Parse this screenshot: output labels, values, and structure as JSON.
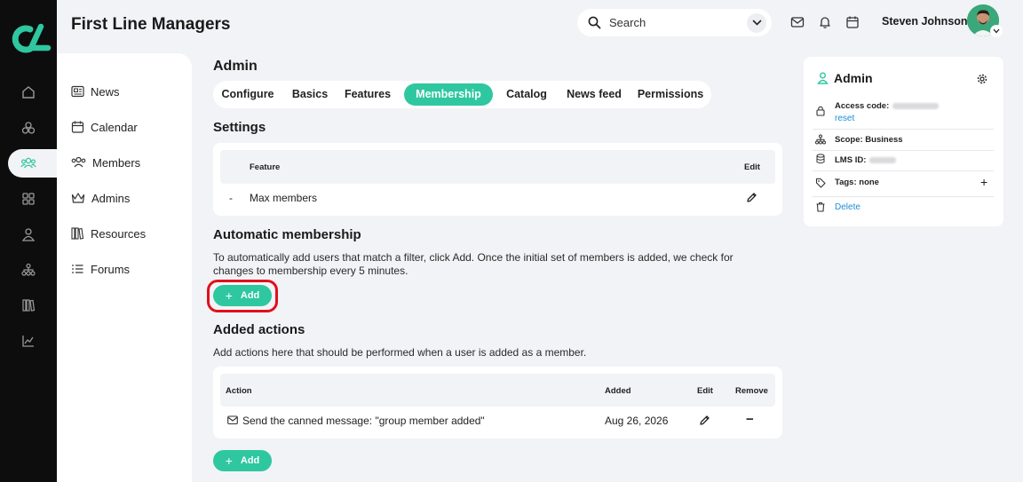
{
  "header": {
    "app_title": "First Line Managers",
    "search_placeholder": "Search",
    "user_name": "Steven Johnson"
  },
  "sidebar": {
    "items": [
      {
        "label": "News",
        "icon": "news-icon"
      },
      {
        "label": "Calendar",
        "icon": "calendar-icon"
      },
      {
        "label": "Members",
        "icon": "members-icon"
      },
      {
        "label": "Admins",
        "icon": "crown-icon"
      },
      {
        "label": "Resources",
        "icon": "books-icon"
      },
      {
        "label": "Forums",
        "icon": "list-icon"
      }
    ]
  },
  "rail": {
    "icons": [
      "home-icon",
      "groups-icon",
      "members-icon",
      "apps-icon",
      "user-icon",
      "org-chart-icon",
      "library-icon",
      "analytics-icon"
    ],
    "active": "members-icon"
  },
  "main": {
    "title": "Admin",
    "tabs": [
      "Configure",
      "Basics",
      "Features",
      "Membership",
      "Catalog",
      "News feed",
      "Permissions"
    ],
    "active_tab": "Membership",
    "settings": {
      "title": "Settings",
      "columns": [
        "Feature",
        "Edit"
      ],
      "rows": [
        {
          "marker": "-",
          "feature": "Max members"
        }
      ]
    },
    "automatic": {
      "title": "Automatic membership",
      "description_line1": "To automatically add users that match a filter, click Add. Once the initial set of members is added, we check for",
      "description_line2": "changes to membership every 5 minutes.",
      "add_label": "Add"
    },
    "actions": {
      "title": "Added actions",
      "description": "Add actions here that should be performed when a user is added as a member.",
      "columns": [
        "Action",
        "Added",
        "Edit",
        "Remove"
      ],
      "rows": [
        {
          "action": "Send the canned message: \"group member added\"",
          "added": "Aug 26, 2026",
          "remove": "−"
        }
      ],
      "add_label": "Add"
    }
  },
  "right_panel": {
    "title": "Admin",
    "access_code_label": "Access code:",
    "reset_label": "reset",
    "scope": "Scope: Business",
    "lms_label": "LMS ID:",
    "tags": "Tags: none",
    "tags_add": "+",
    "delete_label": "Delete"
  },
  "colors": {
    "accent": "#2ec7a0",
    "rail": "#0d0d0d",
    "link": "#1a8fd6",
    "highlight": "#e0101c"
  }
}
